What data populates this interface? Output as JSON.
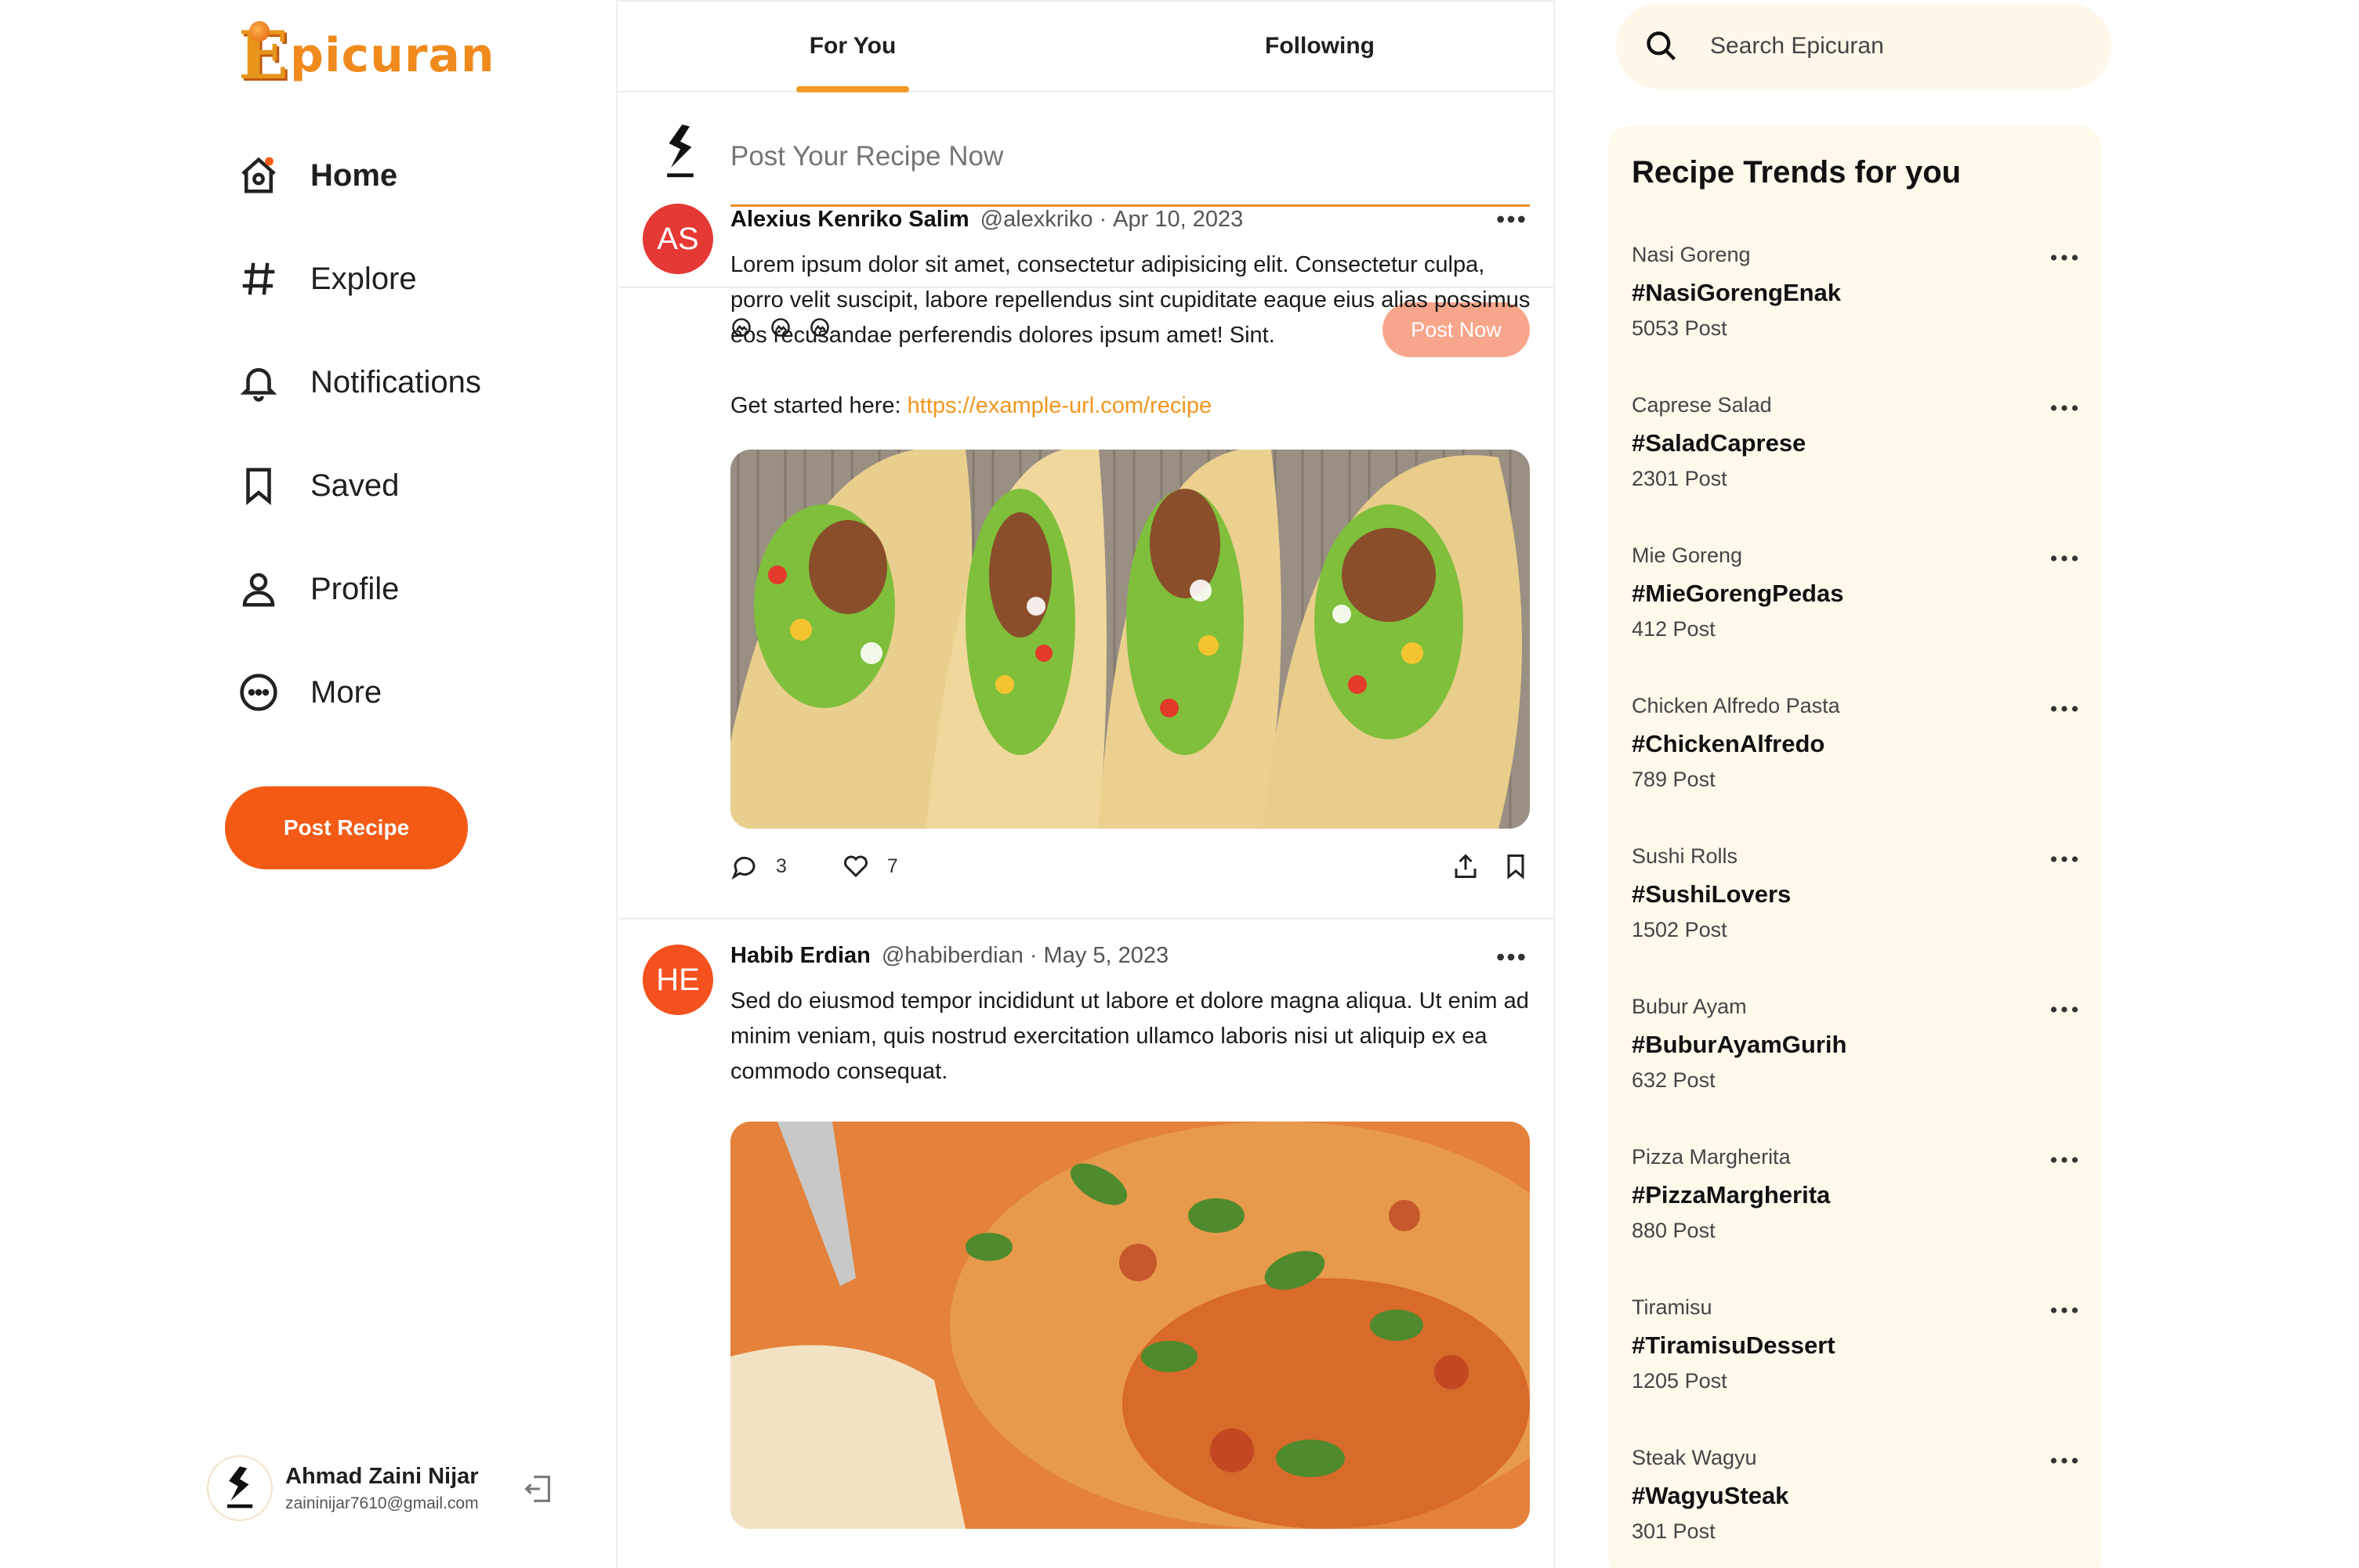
{
  "brand": {
    "logo_first": "E",
    "logo_rest": "picuran"
  },
  "nav": {
    "items": [
      {
        "label": "Home",
        "icon": "home-icon"
      },
      {
        "label": "Explore",
        "icon": "hashtag-icon"
      },
      {
        "label": "Notifications",
        "icon": "bell-icon"
      },
      {
        "label": "Saved",
        "icon": "bookmark-icon"
      },
      {
        "label": "Profile",
        "icon": "user-icon"
      },
      {
        "label": "More",
        "icon": "more-circle-icon"
      }
    ],
    "active": "Home",
    "post_recipe_label": "Post Recipe"
  },
  "user": {
    "name": "Ahmad Zaini Nijar",
    "email": "zaininijar7610@gmail.com"
  },
  "tabs": [
    {
      "label": "For You",
      "active": true
    },
    {
      "label": "Following",
      "active": false
    }
  ],
  "composer": {
    "placeholder": "Post Your Recipe Now",
    "post_label": "Post Now"
  },
  "posts": [
    {
      "initials": "AS",
      "avatar_color": "#e53935",
      "author": "Alexius Kenriko Salim",
      "handle": "@alexkriko",
      "date": "Apr 10, 2023",
      "body": "Lorem ipsum dolor sit amet, consectetur adipisicing elit. Consectetur culpa, porro velit suscipit, labore repellendus sint cupiditate eaque eius alias possimus eos recusandae perferendis dolores ipsum amet! Sint.",
      "link_prefix": "Get started here: ",
      "link": "https://example-url.com/recipe",
      "comments": "3",
      "likes": "7"
    },
    {
      "initials": "HE",
      "avatar_color": "#f4511e",
      "author": "Habib Erdian",
      "handle": "@habiberdian",
      "date": "May 5, 2023",
      "body": "Sed do eiusmod tempor incididunt ut labore et dolore magna aliqua. Ut enim ad minim veniam, quis nostrud exercitation ullamco laboris nisi ut aliquip ex ea commodo consequat."
    }
  ],
  "search": {
    "placeholder": "Search Epicuran"
  },
  "trends": {
    "title": "Recipe Trends for you",
    "items": [
      {
        "category": "Nasi Goreng",
        "tag": "#NasiGorengEnak",
        "count": "5053 Post"
      },
      {
        "category": "Caprese Salad",
        "tag": "#SaladCaprese",
        "count": "2301 Post"
      },
      {
        "category": "Mie Goreng",
        "tag": "#MieGorengPedas",
        "count": "412 Post"
      },
      {
        "category": "Chicken Alfredo Pasta",
        "tag": "#ChickenAlfredo",
        "count": "789 Post"
      },
      {
        "category": "Sushi Rolls",
        "tag": "#SushiLovers",
        "count": "1502 Post"
      },
      {
        "category": "Bubur Ayam",
        "tag": "#BuburAyamGurih",
        "count": "632 Post"
      },
      {
        "category": "Pizza Margherita",
        "tag": "#PizzaMargherita",
        "count": "880 Post"
      },
      {
        "category": "Tiramisu",
        "tag": "#TiramisuDessert",
        "count": "1205 Post"
      },
      {
        "category": "Steak Wagyu",
        "tag": "#WagyuSteak",
        "count": "301 Post"
      }
    ]
  },
  "colors": {
    "accent": "#f35b15",
    "tab_indicator": "#f49a24",
    "link": "#f3961f",
    "trend_bg": "#fff9ec"
  }
}
